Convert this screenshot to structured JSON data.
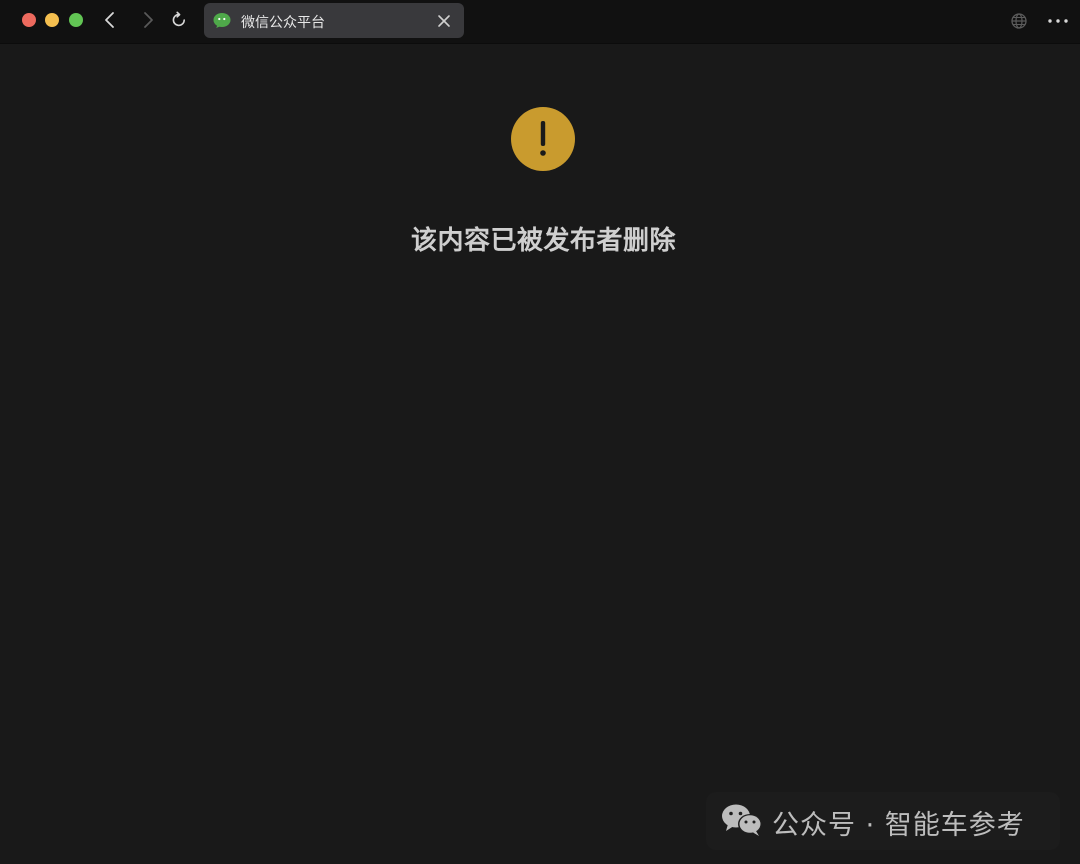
{
  "window": {
    "traffic_lights": [
      "close",
      "minimize",
      "maximize"
    ]
  },
  "toolbar": {
    "back_icon": "chevron-left-icon",
    "forward_icon": "chevron-right-icon",
    "reload_icon": "reload-icon",
    "globe_icon": "globe-icon",
    "more_icon": "more-dots-icon"
  },
  "tab": {
    "title": "微信公众平台",
    "icon": "wechat-icon",
    "close_icon": "close-icon"
  },
  "main": {
    "alert_icon": "exclamation-warning-icon",
    "alert_color": "#c99b2e",
    "message": "该内容已被发布者删除"
  },
  "watermark": {
    "icon": "wechat-icon",
    "text": "公众号 · 智能车参考"
  }
}
